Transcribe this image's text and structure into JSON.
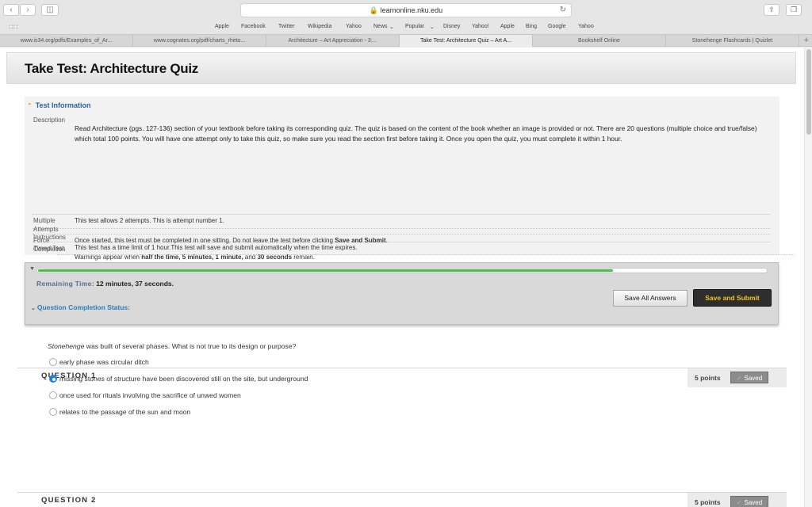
{
  "browser": {
    "url": "learnonline.nku.edu",
    "favorites": [
      "Apple",
      "Facebook",
      "Twitter",
      "Wikipedia",
      "Yahoo",
      "News",
      "Popular",
      "Disney",
      "Yahoo!",
      "Apple",
      "Bing",
      "Google",
      "Yahoo"
    ],
    "tabs": [
      "www.is34.org/pdfs/Examples_of_Ar...",
      "www.cognates.org/pdf/charts_rheto...",
      "Architecture – Art Appreciation - 3:...",
      "Take Test: Architecture Quiz – Art A...",
      "Bookshelf Online",
      "Stonehenge Flashcards | Quizlet"
    ],
    "active_tab": 3
  },
  "page": {
    "title": "Take Test: Architecture Quiz"
  },
  "info": {
    "heading": "Test Information",
    "description_label": "Description",
    "description": "Read Architecture (pgs. 127-136) section of your textbook before taking its corresponding quiz. The quiz is based on the content of the book whether an image is provided or not. There are 20 questions (multiple choice and true/false) which total 100 points. You will have one attempt only to take this quiz, so make sure you read the section first before taking it. Once you open the quiz, you must complete it within 1 hour.",
    "instructions_label": "Instructions",
    "timed_label": "Timed Test",
    "timed_text_1": "This test has a time limit of 1 hour.This test will save and submit automatically when the time expires.",
    "timed_text_2a": "Warnings appear when ",
    "timed_text_2b": "half the time, 5 minutes, 1 minute,",
    "timed_text_2c": " and ",
    "timed_text_2d": "30 seconds",
    "timed_text_2e": " remain.",
    "multiple_label_1": "Multiple",
    "multiple_label_2": "Attempts",
    "multiple_text": "This test allows 2 attempts. This is attempt number 1.",
    "force_label_1": "Force",
    "force_label_2": "Completion",
    "force_text_a": "Once started, this test must be completed in one sitting. Do not leave the test before clicking ",
    "force_text_b": "Save and Submit",
    "force_text_c": "."
  },
  "timer": {
    "progress_fraction": 0.79,
    "remaining_label": "Remaining Time:",
    "remaining_value": "12 minutes, 37 seconds.",
    "completion_status": "Question Completion Status:"
  },
  "actions": {
    "save_all": "Save All Answers",
    "save_submit": "Save and Submit"
  },
  "questions": [
    {
      "title": "QUESTION 1",
      "points": "5 points",
      "saved": "Saved",
      "text_em": "Stonehenge",
      "text_rest": " was built of several phases. What is not true to its design or purpose?",
      "options": [
        "early phase was circular ditch",
        "missing stones of structure have been discovered still on the site, but underground",
        "once used for rituals involving the sacrifice of unwed women",
        "relates to the passage of the sun and moon"
      ],
      "selected": 1
    },
    {
      "title": "QUESTION 2",
      "points": "5 points",
      "saved": "Saved"
    }
  ],
  "colors": {
    "accent_blue": "#2b5fa8",
    "progress_green": "#4cbb4c",
    "submit_text": "#f5c518"
  }
}
